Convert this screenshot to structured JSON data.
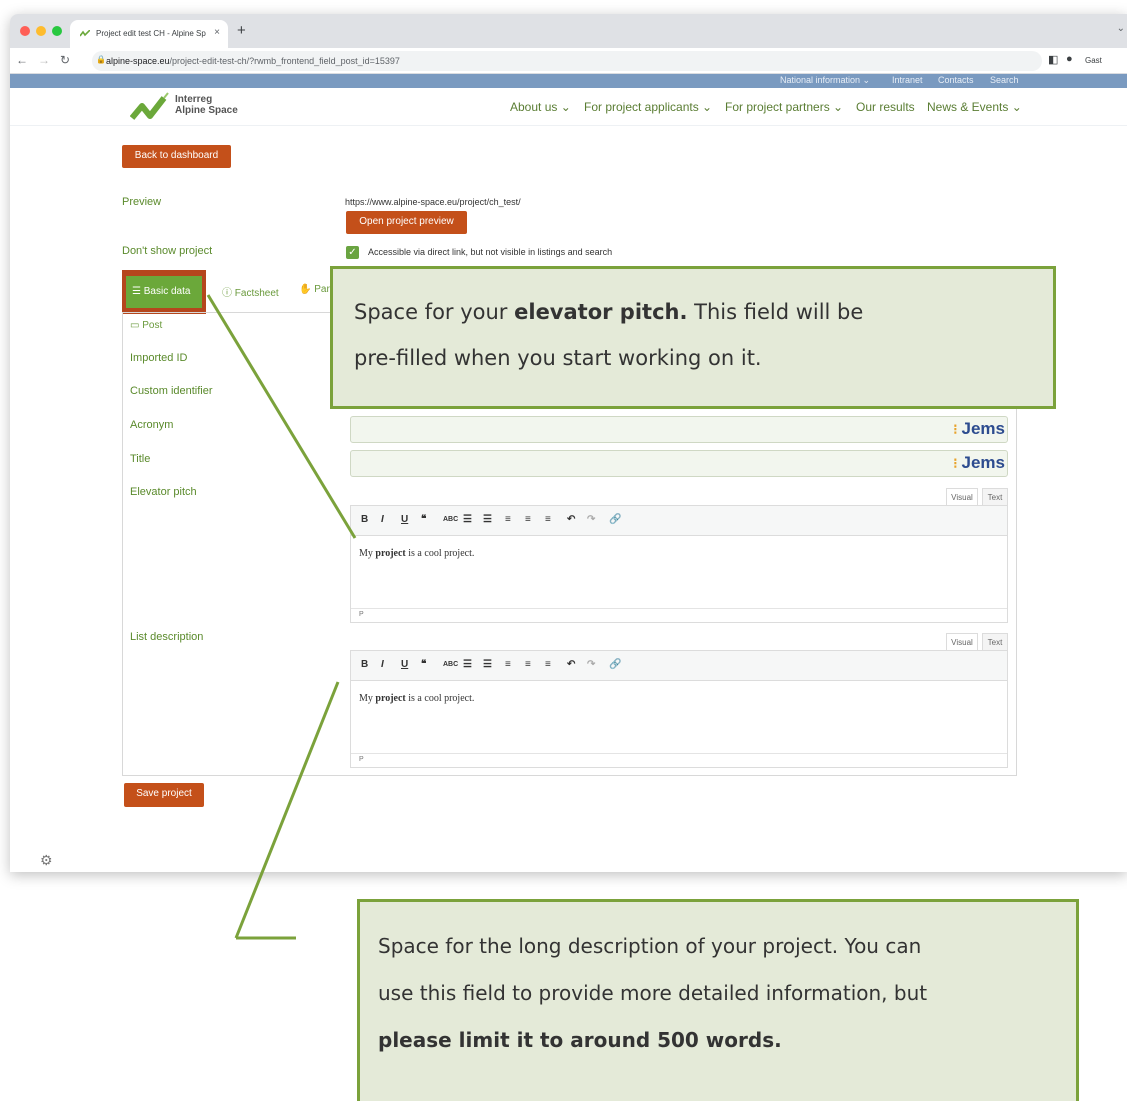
{
  "browser": {
    "tab_title": "Project edit test CH - Alpine Sp",
    "tab_close": "×",
    "new_tab": "+",
    "url_domain": "alpine-space.eu",
    "url_path": "/project-edit-test-ch/?rwmb_frontend_field_post_id=15397",
    "profile_label": "Gast"
  },
  "site": {
    "top_nav": [
      "National information ⌄",
      "Intranet",
      "Contacts",
      "Search"
    ],
    "logo_line1": "Interreg",
    "logo_line2": "Alpine Space",
    "main_nav": [
      "About us ⌄",
      "For project applicants ⌄",
      "For project partners ⌄",
      "Our results",
      "News & Events ⌄"
    ]
  },
  "page": {
    "back_button": "Back to dashboard",
    "preview_label": "Preview",
    "preview_url": "https://www.alpine-space.eu/project/ch_test/",
    "open_preview_button": "Open project preview",
    "dont_show_label": "Don't show project",
    "dont_show_text": "Accessible via direct link, but not visible in listings and search",
    "tabs": [
      "Basic data",
      "Factsheet",
      "Partn"
    ],
    "post_label": "Post",
    "fields": {
      "imported_id": "Imported ID",
      "custom_identifier": "Custom identifier",
      "acronym": "Acronym",
      "title": "Title",
      "elevator_pitch": "Elevator pitch",
      "list_description": "List description"
    },
    "jems_label": "Jems",
    "editor_tabs": [
      "Visual",
      "Text"
    ],
    "editor_content_prefix": "My ",
    "editor_content_bold": "project",
    "editor_content_suffix": " is a cool project.",
    "editor_footer": "P",
    "save_button": "Save project"
  },
  "callouts": {
    "pitch_part1": "Space for your ",
    "pitch_bold": "elevator pitch.",
    "pitch_part2": " This field will be",
    "pitch_line2": "pre-filled when you start working on it.",
    "desc_line1": "Space for the long description of your project. You can",
    "desc_line2": "use this field to provide more detailed information, but",
    "desc_bold": "please limit it to around 500 words."
  },
  "colors": {
    "accent_orange": "#c4501a",
    "accent_green": "#6ba83a",
    "callout_bg": "#e4ead8",
    "callout_border": "#7ba23b"
  }
}
